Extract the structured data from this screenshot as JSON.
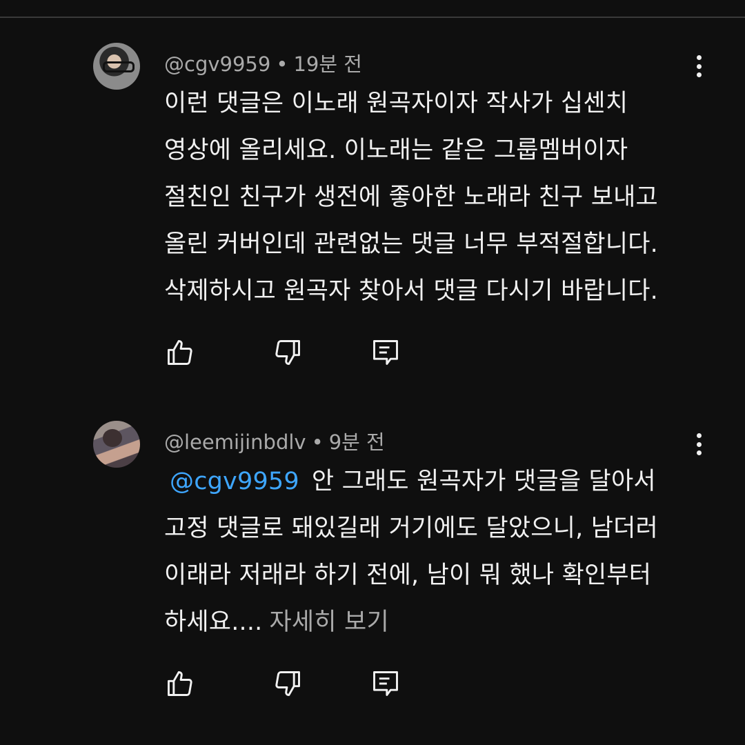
{
  "comments": [
    {
      "author": "@cgv9959",
      "separator": "•",
      "time": "19분 전",
      "lines": [
        "이런 댓글은 이노래 원곡자이자 작사가 십센치",
        "영상에 올리세요. 이노래는 같은 그룹멤버이자",
        "절친인 친구가 생전에 좋아한 노래라 친구 보내고",
        "올린 커버인데 관련없는 댓글 너무 부적절합니다.",
        "삭제하시고 원곡자 찾아서 댓글 다시기 바랍니다."
      ]
    },
    {
      "author": "@leemijinbdlv",
      "separator": "•",
      "time": "9분 전",
      "mention": "@cgv9959",
      "line1_rest": "안 그래도 원곡자가 댓글을 달아서",
      "lines": [
        "고정 댓글로 돼있길래 거기에도 달았으니, 남더러",
        "이래라 저래라 하기 전에, 남이 뭐 했나 확인부터"
      ],
      "last_line": "하세요....",
      "read_more": "자세히 보기"
    }
  ],
  "icons": {
    "like": "thumb-up-icon",
    "dislike": "thumb-down-icon",
    "reply": "comment-reply-icon",
    "more": "more-vertical-icon"
  },
  "colors": {
    "background": "#0f0f0f",
    "text": "#f1f1f1",
    "secondary": "#aaaaaa",
    "mention": "#3ea6ff"
  }
}
